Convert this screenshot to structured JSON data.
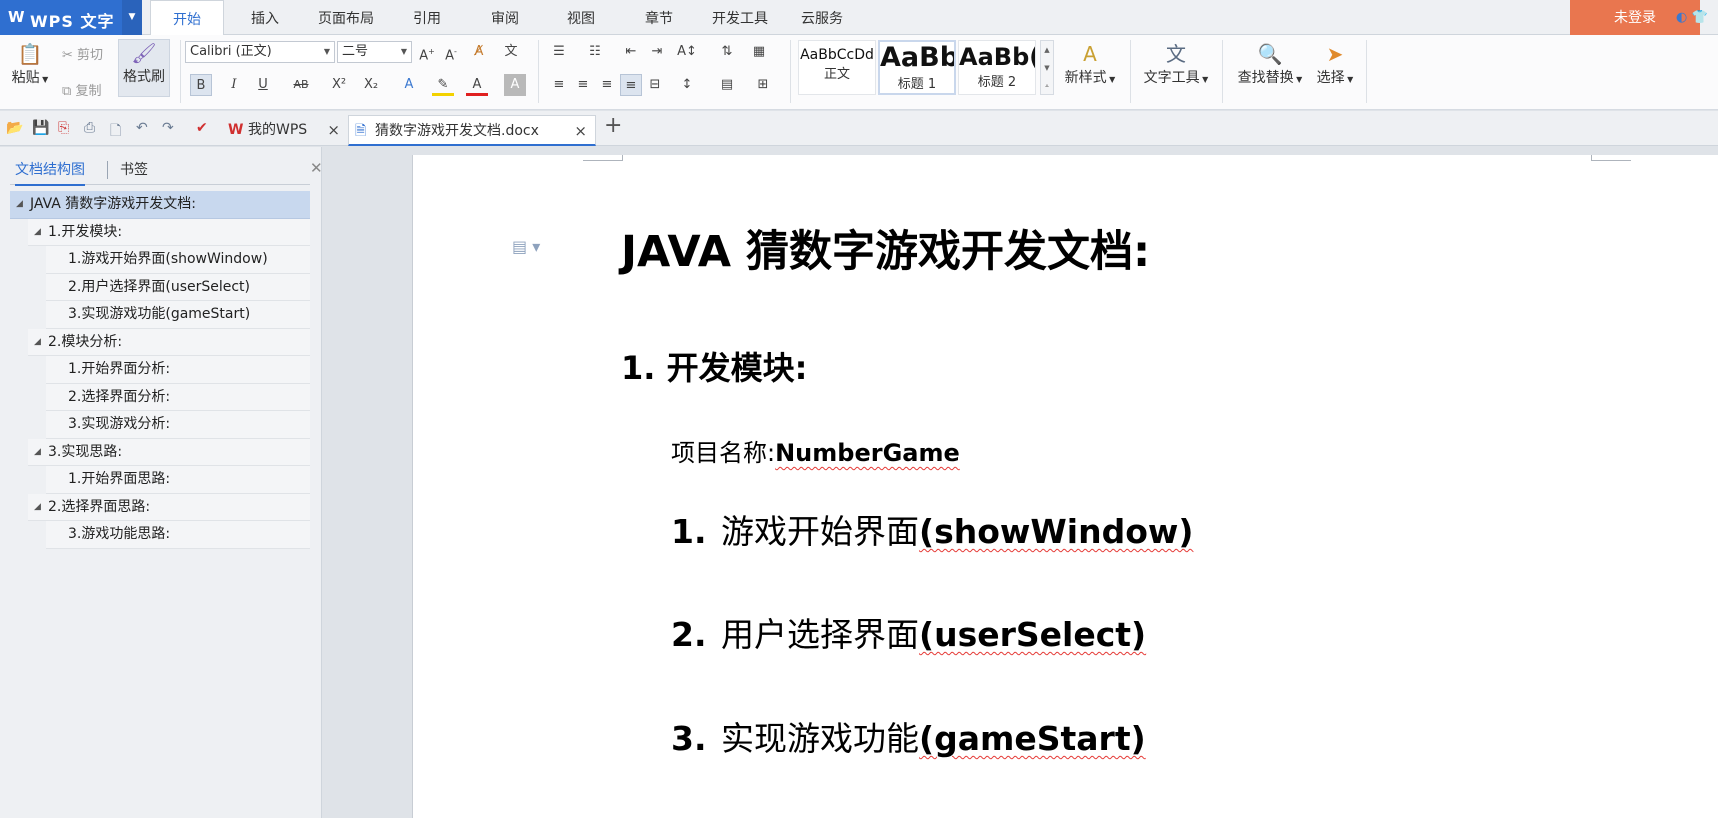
{
  "app": {
    "logo": "W",
    "name": "WPS 文字",
    "login": "未登录"
  },
  "menu_tabs": [
    "开始",
    "插入",
    "页面布局",
    "引用",
    "审阅",
    "视图",
    "章节",
    "开发工具",
    "云服务"
  ],
  "ribbon": {
    "paste": "粘贴",
    "cut": "剪切",
    "copy": "复制",
    "format_painter": "格式刷",
    "font_name": "Calibri (正文)",
    "font_size": "二号",
    "bold": "B",
    "italic": "I",
    "underline": "U",
    "styles": [
      {
        "sample": "AaBbCcDd",
        "name": "正文"
      },
      {
        "sample": "AaBb",
        "name": "标题 1"
      },
      {
        "sample": "AaBb(",
        "name": "标题 2"
      }
    ],
    "new_style": "新样式",
    "text_tools": "文字工具",
    "find_replace": "查找替换",
    "select": "选择"
  },
  "doc_tabs": [
    {
      "label": "我的WPS"
    },
    {
      "label": "猜数字游戏开发文档.docx"
    }
  ],
  "nav": {
    "tabs": [
      "文档结构图",
      "书签"
    ],
    "outline": [
      {
        "text": "JAVA 猜数字游戏开发文档:",
        "level": 0,
        "expandable": true
      },
      {
        "text": "1.开发模块:",
        "level": 1,
        "expandable": true
      },
      {
        "text": "1.游戏开始界面(showWindow)",
        "level": 2,
        "expandable": false
      },
      {
        "text": "2.用户选择界面(userSelect)",
        "level": 2,
        "expandable": false
      },
      {
        "text": "3.实现游戏功能(gameStart)",
        "level": 2,
        "expandable": false
      },
      {
        "text": "2.模块分析:",
        "level": 1,
        "expandable": true
      },
      {
        "text": "1.开始界面分析:",
        "level": 2,
        "expandable": false
      },
      {
        "text": "2.选择界面分析:",
        "level": 2,
        "expandable": false
      },
      {
        "text": "3.实现游戏分析:",
        "level": 2,
        "expandable": false
      },
      {
        "text": "3.实现思路:",
        "level": 1,
        "expandable": true
      },
      {
        "text": "1.开始界面思路:",
        "level": 2,
        "expandable": false
      },
      {
        "text": "2.选择界面思路:",
        "level": 1,
        "expandable": true
      },
      {
        "text": "3.游戏功能思路:",
        "level": 2,
        "expandable": false
      }
    ]
  },
  "document": {
    "title": "JAVA 猜数字游戏开发文档:",
    "heading": "1. 开发模块:",
    "project_label": "项目名称:",
    "project_name": "NumberGame",
    "items": [
      {
        "num": "1.",
        "cn": "游戏开始界面",
        "en": "(showWindow)"
      },
      {
        "num": "2.",
        "cn": "用户选择界面",
        "en": "(userSelect)"
      },
      {
        "num": "3.",
        "cn": "实现游戏功能",
        "en": "(gameStart)"
      }
    ]
  }
}
